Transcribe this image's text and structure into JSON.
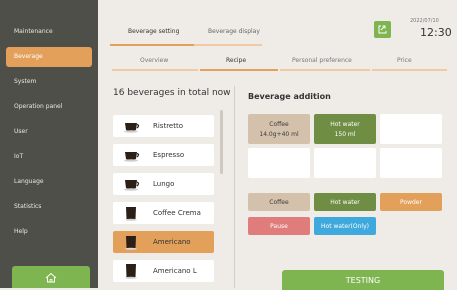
{
  "sidebar": {
    "items": [
      {
        "label": "Maintenance"
      },
      {
        "label": "Beverage"
      },
      {
        "label": "System"
      },
      {
        "label": "Operation panel"
      },
      {
        "label": "User"
      },
      {
        "label": "IoT"
      },
      {
        "label": "Language"
      },
      {
        "label": "Statistics"
      },
      {
        "label": "Help"
      }
    ],
    "active_index": 1
  },
  "header": {
    "tabs": [
      {
        "label": "Beverage setting"
      },
      {
        "label": "Beverage display"
      }
    ],
    "date": "2022/07/10",
    "time": "12:30"
  },
  "subtabs": [
    {
      "label": "Overview"
    },
    {
      "label": "Recipe"
    },
    {
      "label": "Personal preference"
    },
    {
      "label": "Price"
    }
  ],
  "beverages": {
    "title": "16 beverages in total now",
    "items": [
      {
        "label": "Ristretto"
      },
      {
        "label": "Espresso"
      },
      {
        "label": "Lungo"
      },
      {
        "label": "Coffee Crema"
      },
      {
        "label": "Americano"
      },
      {
        "label": "Americano L"
      }
    ],
    "selected_index": 4
  },
  "addition": {
    "title": "Beverage addition",
    "steps": [
      {
        "name": "Coffee",
        "value": "14.0g+40 ml"
      },
      {
        "name": "Hot water",
        "value": "150 ml"
      }
    ],
    "options": [
      {
        "label": "Coffee"
      },
      {
        "label": "Hot water"
      },
      {
        "label": "Powder"
      },
      {
        "label": "Pause"
      },
      {
        "label": "Hot water(Only)"
      }
    ]
  },
  "testing_button": "TESTING",
  "colors": {
    "sidebar": "#4f4f4a",
    "accent_orange": "#e3a05b",
    "green": "#7fb551",
    "coffee_tan": "#d3c1ab",
    "olive": "#6f8d43",
    "pause_red": "#e07c7c",
    "blue": "#3fa8dd"
  }
}
